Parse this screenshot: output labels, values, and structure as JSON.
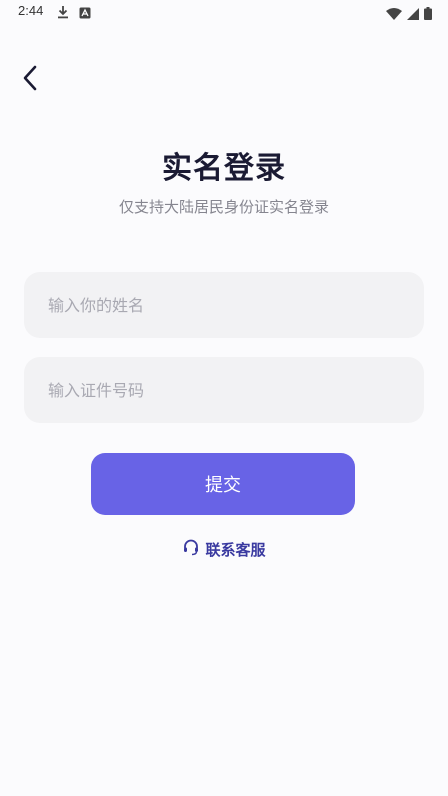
{
  "status_bar": {
    "time": "2:44",
    "icons": [
      "download-icon",
      "app-notification-icon",
      "wifi-icon",
      "signal-icon",
      "battery-icon"
    ]
  },
  "header": {
    "back_icon": "chevron-left-icon"
  },
  "page": {
    "title": "实名登录",
    "subtitle": "仅支持大陆居民身份证实名登录"
  },
  "form": {
    "name_placeholder": "输入你的姓名",
    "name_value": "",
    "id_placeholder": "输入证件号码",
    "id_value": "",
    "submit_label": "提交"
  },
  "support": {
    "contact_label": "联系客服",
    "icon": "headset-icon"
  },
  "colors": {
    "accent": "#6863e6",
    "title": "#1a1a33",
    "link": "#3a3aa0",
    "input_bg": "#f2f2f4"
  }
}
